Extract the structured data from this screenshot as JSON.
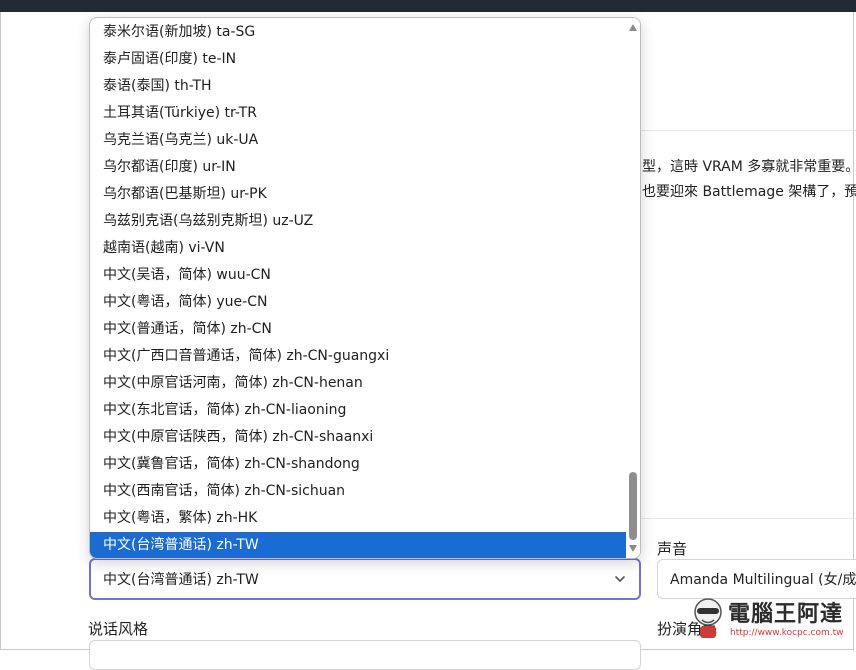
{
  "background": {
    "article_line1": "型，這時 VRAM 多寡就非常重要。",
    "article_line2": "也要迎來 Battlemage 架構了，預計"
  },
  "language_dropdown": {
    "options": [
      "泰米尔语(新加坡) ta-SG",
      "泰卢固语(印度) te-IN",
      "泰语(泰国) th-TH",
      "土耳其语(Türkiye) tr-TR",
      "乌克兰语(乌克兰) uk-UA",
      "乌尔都语(印度) ur-IN",
      "乌尔都语(巴基斯坦) ur-PK",
      "乌兹别克语(乌兹别克斯坦) uz-UZ",
      "越南语(越南) vi-VN",
      "中文(吴语，简体) wuu-CN",
      "中文(粤语，简体) yue-CN",
      "中文(普通话，简体) zh-CN",
      "中文(广西口音普通话，简体) zh-CN-guangxi",
      "中文(中原官话河南，简体) zh-CN-henan",
      "中文(东北官话，简体) zh-CN-liaoning",
      "中文(中原官话陕西，简体) zh-CN-shaanxi",
      "中文(冀鲁官话，简体) zh-CN-shandong",
      "中文(西南官话，简体) zh-CN-sichuan",
      "中文(粤语，繁体) zh-HK",
      "中文(台湾普通话) zh-TW"
    ],
    "selected_value": "中文(台湾普通话) zh-TW",
    "selected_color": "#1a6bd2"
  },
  "voice": {
    "label": "声音",
    "value": "Amanda Multilingual (女/成年"
  },
  "style": {
    "label": "说话风格"
  },
  "role": {
    "label": "扮演角色"
  },
  "watermark": {
    "title": "電腦王阿達",
    "url": "http://www.kocpc.com.tw"
  },
  "colors": {
    "focus_border": "#6f73d6",
    "top_bar": "#232a34"
  }
}
